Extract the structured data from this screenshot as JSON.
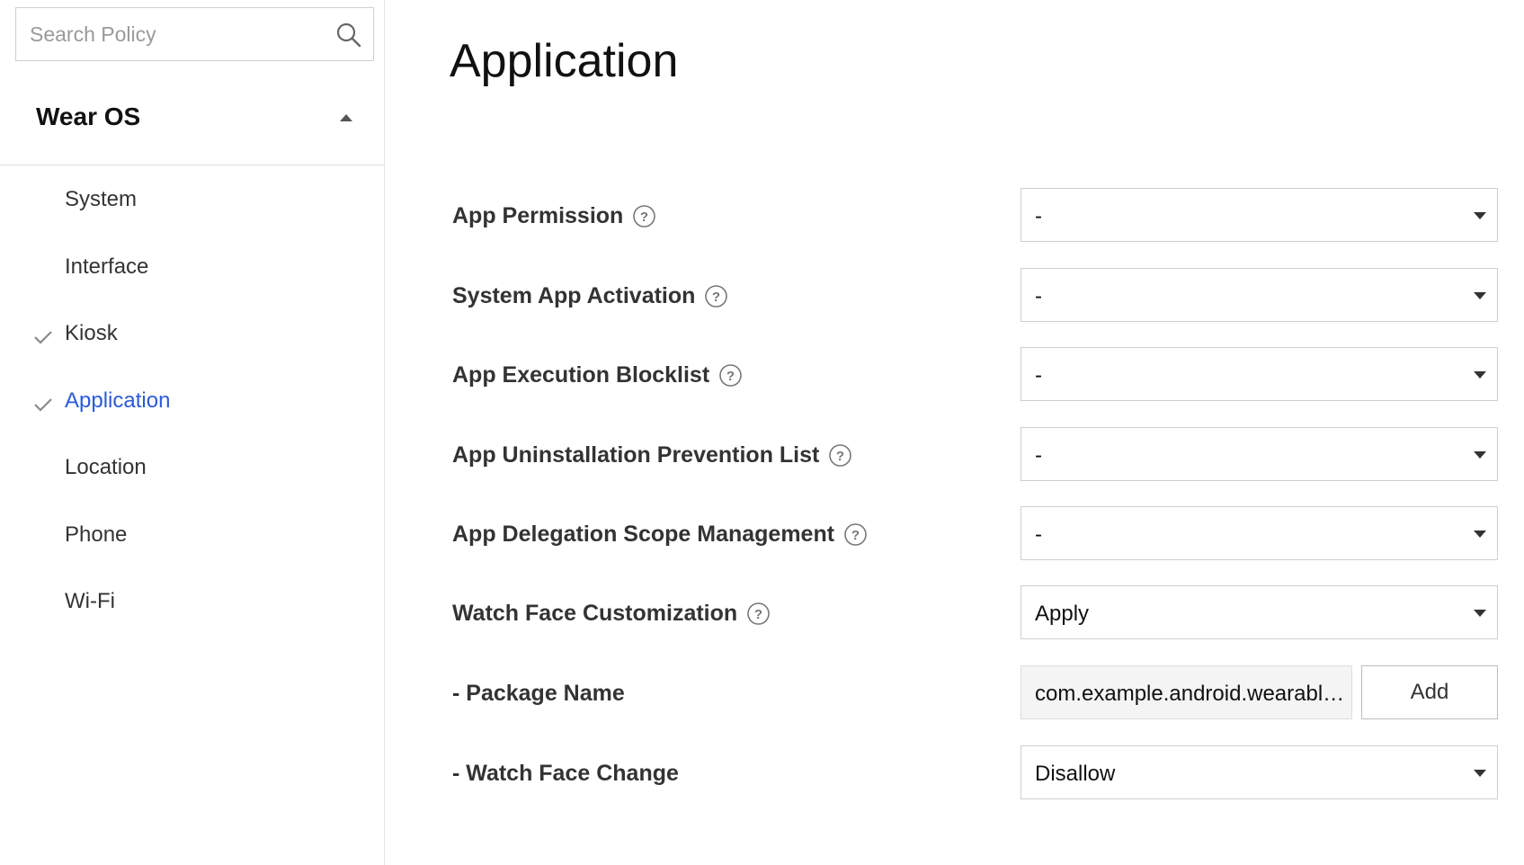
{
  "search": {
    "placeholder": "Search Policy",
    "value": ""
  },
  "sidebar": {
    "section_title": "Wear OS",
    "items": [
      {
        "label": "System",
        "checked": false,
        "active": false
      },
      {
        "label": "Interface",
        "checked": false,
        "active": false
      },
      {
        "label": "Kiosk",
        "checked": true,
        "active": false
      },
      {
        "label": "Application",
        "checked": true,
        "active": true
      },
      {
        "label": "Location",
        "checked": false,
        "active": false
      },
      {
        "label": "Phone",
        "checked": false,
        "active": false
      },
      {
        "label": "Wi-Fi",
        "checked": false,
        "active": false
      }
    ]
  },
  "main": {
    "title": "Application",
    "policies": [
      {
        "label": "App Permission",
        "value": "-"
      },
      {
        "label": "System App Activation",
        "value": "-"
      },
      {
        "label": "App Execution Blocklist",
        "value": "-"
      },
      {
        "label": "App Uninstallation Prevention List",
        "value": "-"
      },
      {
        "label": "App Delegation Scope Management",
        "value": "-"
      },
      {
        "label": "Watch Face Customization",
        "value": "Apply"
      }
    ],
    "package_name": {
      "label": "- Package Name",
      "value": "com.example.android.wearable.watchface",
      "add_label": "Add"
    },
    "watch_face_change": {
      "label": "- Watch Face Change",
      "value": "Disallow"
    }
  },
  "colors": {
    "accent": "#2c5ad8",
    "border": "#cfcfcf",
    "input_readonly_bg": "#f4f4f4"
  },
  "icons": {
    "search": "search-icon",
    "collapse": "caret-up-icon",
    "dropdown": "caret-down-icon",
    "check": "check-icon",
    "help": "help-circle-icon"
  }
}
